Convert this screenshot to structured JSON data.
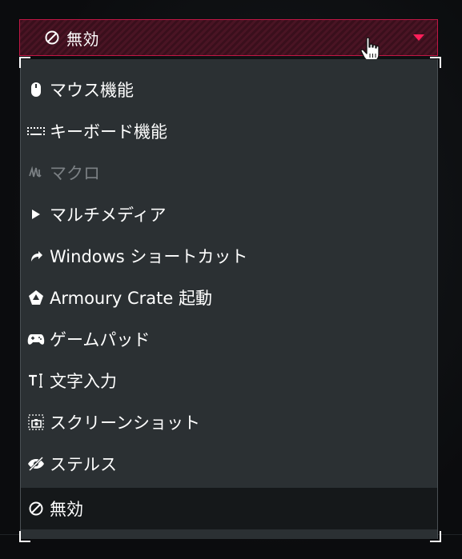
{
  "dropdown": {
    "selected_label": "無効",
    "selected_icon": "prohibit-icon",
    "accent_color": "#ff1f5a"
  },
  "menu": {
    "items": [
      {
        "label": "マウス機能",
        "icon": "mouse-icon",
        "enabled": true,
        "selected": false
      },
      {
        "label": "キーボード機能",
        "icon": "keyboard-icon",
        "enabled": true,
        "selected": false
      },
      {
        "label": "マクロ",
        "icon": "macro-icon",
        "enabled": false,
        "selected": false
      },
      {
        "label": "マルチメディア",
        "icon": "play-icon",
        "enabled": true,
        "selected": false
      },
      {
        "label": "Windows ショートカット",
        "icon": "shortcut-arrow-icon",
        "enabled": true,
        "selected": false
      },
      {
        "label": "Armoury Crate 起動",
        "icon": "armoury-crate-icon",
        "enabled": true,
        "selected": false
      },
      {
        "label": "ゲームパッド",
        "icon": "gamepad-icon",
        "enabled": true,
        "selected": false
      },
      {
        "label": "文字入力",
        "icon": "text-input-icon",
        "enabled": true,
        "selected": false
      },
      {
        "label": "スクリーンショット",
        "icon": "screenshot-icon",
        "enabled": true,
        "selected": false
      },
      {
        "label": "ステルス",
        "icon": "stealth-eye-icon",
        "enabled": true,
        "selected": false
      },
      {
        "label": "無効",
        "icon": "prohibit-icon",
        "enabled": true,
        "selected": true
      }
    ]
  }
}
